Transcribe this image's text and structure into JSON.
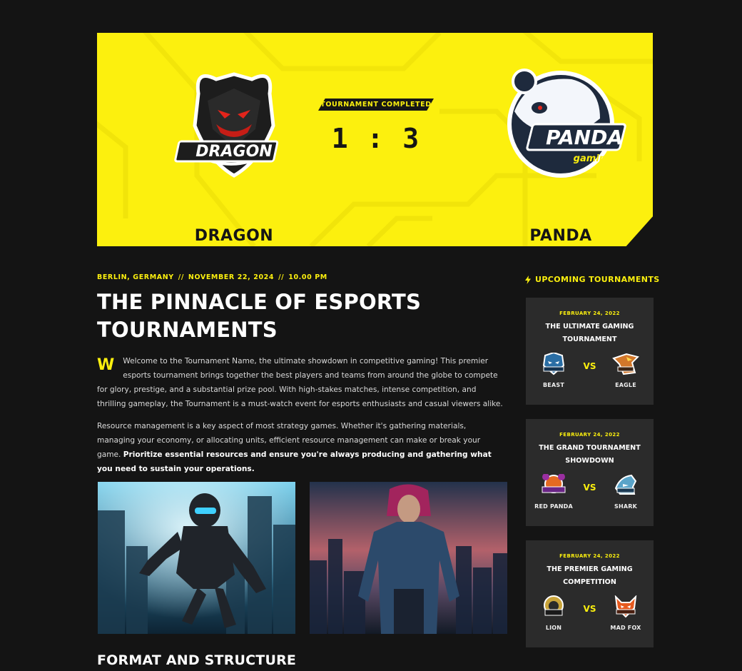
{
  "hero": {
    "status": "TOURNAMENT COMPLETED",
    "score": "1 : 3",
    "team_left": {
      "name": "DRAGON",
      "logo_text": "DRAGON"
    },
    "team_right": {
      "name": "PANDA",
      "logo_text": "PANDA",
      "logo_subtext": "gaming"
    }
  },
  "article": {
    "location": "BERLIN, GERMANY",
    "date": "NOVEMBER 22, 2024",
    "time": "10.00 PM",
    "separator": "//",
    "title": "THE PINNACLE OF ESPORTS TOURNAMENTS",
    "dropcap": "W",
    "paragraph_1": "Welcome to the Tournament Name, the ultimate showdown in competitive gaming! This premier esports tournament brings together the best players and teams from around the globe to compete for glory, prestige, and a substantial prize pool. With high-stakes matches, intense competition, and thrilling gameplay, the Tournament is a must-watch event for esports enthusiasts and casual viewers alike.",
    "paragraph_2": "Resource management is a key aspect of most strategy games. Whether it's gathering materials, managing your economy, or allocating units, efficient resource management can make or break your game.",
    "paragraph_2_bold": "Prioritize essential resources and ensure you're always producing and gathering what you need to sustain your operations.",
    "section_title": "FORMAT AND STRUCTURE"
  },
  "sidebar": {
    "heading": "UPCOMING TOURNAMENTS",
    "vs_label": "VS",
    "cards": [
      {
        "date": "FEBRUARY 24, 2022",
        "title": "THE ULTIMATE GAMING TOURNAMENT",
        "team_left": "BEAST",
        "team_right": "EAGLE"
      },
      {
        "date": "FEBRUARY 24, 2022",
        "title": "THE GRAND TOURNAMENT SHOWDOWN",
        "team_left": "RED PANDA",
        "team_right": "SHARK"
      },
      {
        "date": "FEBRUARY 24, 2022",
        "title": "THE PREMIER GAMING COMPETITION",
        "team_left": "LION",
        "team_right": "MAD FOX"
      }
    ]
  },
  "colors": {
    "accent": "#fcf00e",
    "background": "#141414",
    "card": "#2b2b2b"
  },
  "icons": [
    "bolt-icon",
    "dragon-logo-icon",
    "panda-logo-icon",
    "beast-logo-icon",
    "eagle-logo-icon",
    "red-panda-logo-icon",
    "shark-logo-icon",
    "lion-logo-icon",
    "mad-fox-logo-icon"
  ]
}
